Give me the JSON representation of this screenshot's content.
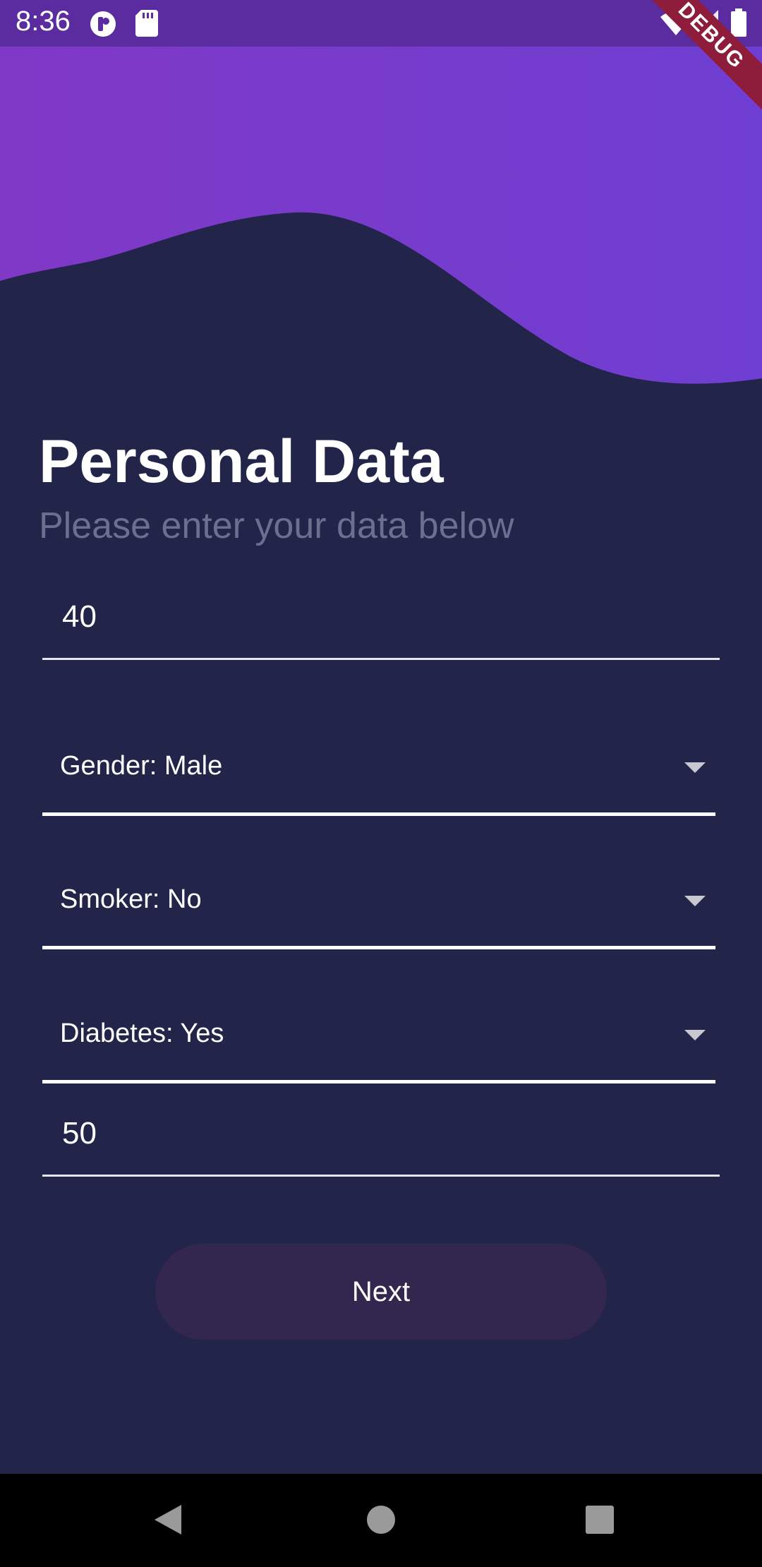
{
  "status_bar": {
    "time": "8:36",
    "debug_banner": "DEBUG",
    "icons": [
      "app-notification-icon",
      "sd-card-icon",
      "wifi-icon",
      "signal-icon",
      "battery-icon"
    ]
  },
  "header": {
    "title": "Personal Data",
    "subtitle": "Please enter your data below"
  },
  "form": {
    "age_value": "40",
    "gender_label": "Gender: Male",
    "smoker_label": "Smoker: No",
    "diabetes_label": "Diabetes: Yes",
    "second_value": "50",
    "next_label": "Next"
  },
  "colors": {
    "background": "#22244a",
    "header_gradient_start": "#8038c6",
    "header_gradient_end": "#6f3ed2",
    "status_bar": "#5a2ca0",
    "button": "#33264f",
    "subtitle": "#6d6f8f"
  },
  "nav": {
    "icons": [
      "back-icon",
      "home-icon",
      "recents-icon"
    ]
  }
}
